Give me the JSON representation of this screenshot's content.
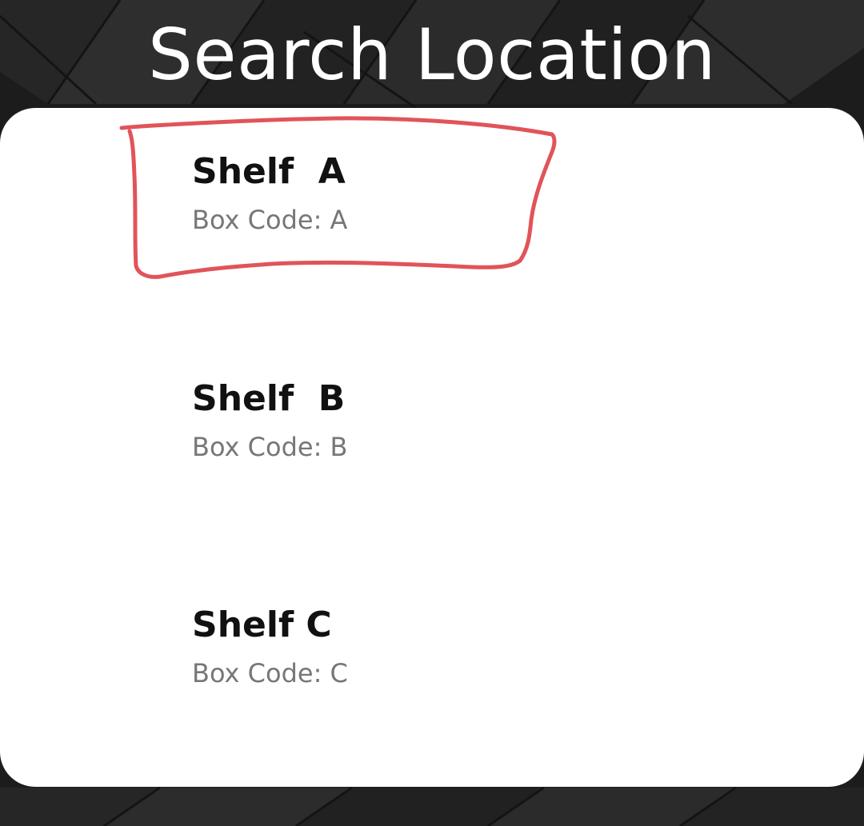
{
  "header": {
    "title": "Search Location"
  },
  "locations": [
    {
      "name": "Shelf  A",
      "box_code": "Box Code: A",
      "highlighted": true
    },
    {
      "name": "Shelf  B",
      "box_code": "Box Code: B",
      "highlighted": false
    },
    {
      "name": "Shelf C",
      "box_code": "Box Code: C",
      "highlighted": false
    }
  ],
  "colors": {
    "background": "#1c1c1c",
    "card": "#ffffff",
    "title_text": "#ffffff",
    "item_title": "#111111",
    "item_subtitle": "#777777",
    "annotation": "#e0545a"
  }
}
